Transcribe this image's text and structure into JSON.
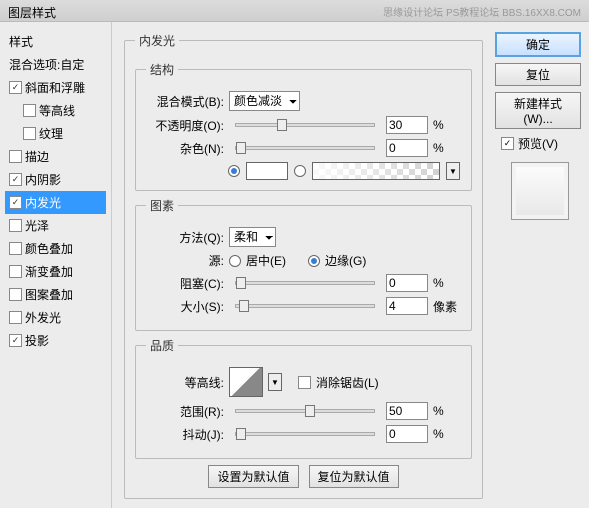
{
  "title": "图层样式",
  "watermark": "思缘设计论坛  PS教程论坛  BBS.16XX8.COM",
  "sidebar": {
    "header": "样式",
    "blend": "混合选项:自定",
    "items": [
      {
        "label": "斜面和浮雕",
        "checked": true,
        "indent": false
      },
      {
        "label": "等高线",
        "checked": false,
        "indent": true
      },
      {
        "label": "纹理",
        "checked": false,
        "indent": true
      },
      {
        "label": "描边",
        "checked": false,
        "indent": false
      },
      {
        "label": "内阴影",
        "checked": true,
        "indent": false
      },
      {
        "label": "内发光",
        "checked": true,
        "indent": false,
        "selected": true
      },
      {
        "label": "光泽",
        "checked": false,
        "indent": false
      },
      {
        "label": "颜色叠加",
        "checked": false,
        "indent": false
      },
      {
        "label": "渐变叠加",
        "checked": false,
        "indent": false
      },
      {
        "label": "图案叠加",
        "checked": false,
        "indent": false
      },
      {
        "label": "外发光",
        "checked": false,
        "indent": false
      },
      {
        "label": "投影",
        "checked": true,
        "indent": false
      }
    ]
  },
  "panel": {
    "title": "内发光",
    "structure": {
      "legend": "结构",
      "blend_mode_label": "混合模式(B):",
      "blend_mode_value": "颜色减淡",
      "opacity_label": "不透明度(O):",
      "opacity_value": "30",
      "opacity_unit": "%",
      "noise_label": "杂色(N):",
      "noise_value": "0",
      "noise_unit": "%"
    },
    "elements": {
      "legend": "图素",
      "technique_label": "方法(Q):",
      "technique_value": "柔和",
      "source_label": "源:",
      "source_center": "居中(E)",
      "source_edge": "边缘(G)",
      "choke_label": "阻塞(C):",
      "choke_value": "0",
      "choke_unit": "%",
      "size_label": "大小(S):",
      "size_value": "4",
      "size_unit": "像素"
    },
    "quality": {
      "legend": "品质",
      "contour_label": "等高线:",
      "antialias_label": "消除锯齿(L)",
      "range_label": "范围(R):",
      "range_value": "50",
      "range_unit": "%",
      "jitter_label": "抖动(J):",
      "jitter_value": "0",
      "jitter_unit": "%"
    },
    "bottom": {
      "default": "设置为默认值",
      "reset": "复位为默认值"
    }
  },
  "right": {
    "ok": "确定",
    "cancel": "复位",
    "new_style": "新建样式(W)...",
    "preview": "预览(V)"
  }
}
